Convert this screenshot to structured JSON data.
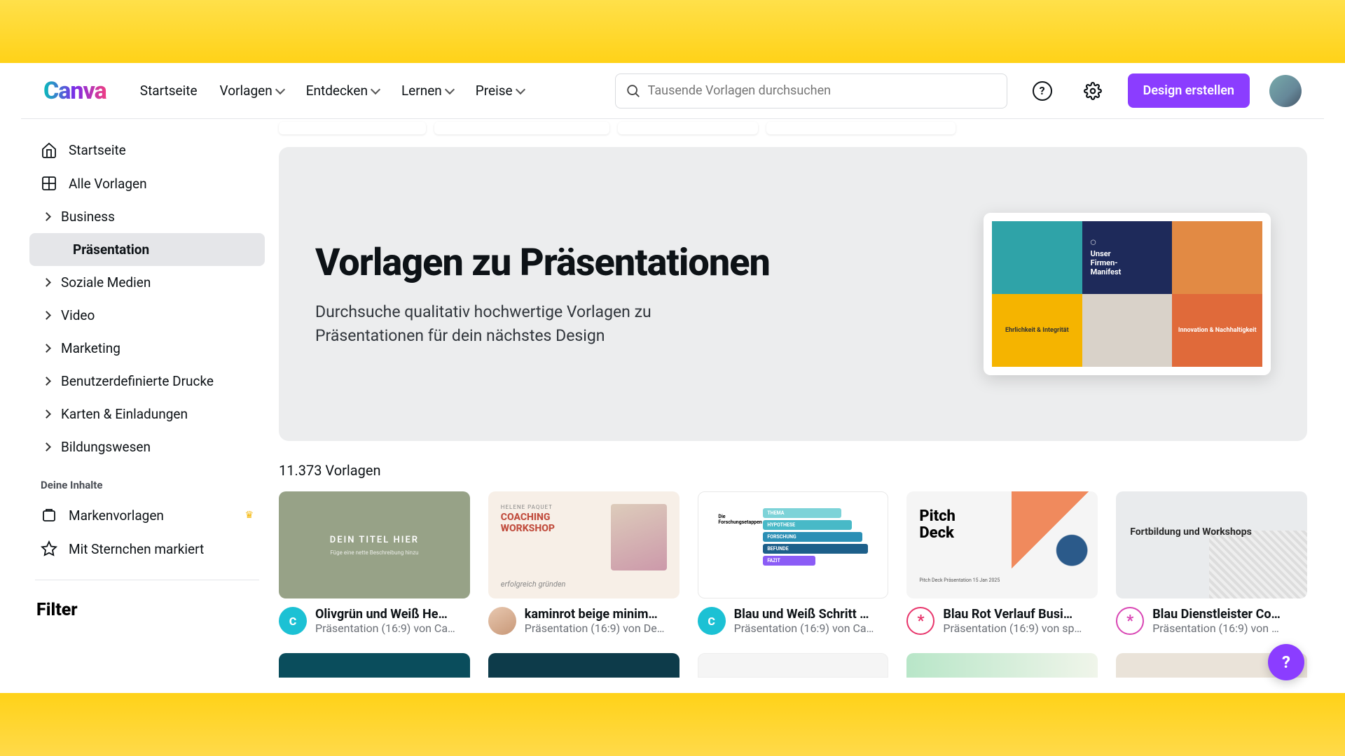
{
  "header": {
    "logo": "Canva",
    "nav": [
      "Startseite",
      "Vorlagen",
      "Entdecken",
      "Lernen",
      "Preise"
    ],
    "search_placeholder": "Tausende Vorlagen durchsuchen",
    "create_label": "Design erstellen"
  },
  "sidebar": {
    "items": [
      {
        "label": "Startseite",
        "icon": "home"
      },
      {
        "label": "Alle Vorlagen",
        "icon": "grid"
      },
      {
        "label": "Business",
        "icon": "chev"
      },
      {
        "label": "Präsentation",
        "icon": "none",
        "active": true,
        "sub": true
      },
      {
        "label": "Soziale Medien",
        "icon": "chev"
      },
      {
        "label": "Video",
        "icon": "chev"
      },
      {
        "label": "Marketing",
        "icon": "chev"
      },
      {
        "label": "Benutzerdefinierte Drucke",
        "icon": "chev"
      },
      {
        "label": "Karten & Einladungen",
        "icon": "chev"
      },
      {
        "label": "Bildungswesen",
        "icon": "chev"
      }
    ],
    "section2_label": "Deine Inhalte",
    "section2_items": [
      {
        "label": "Markenvorlagen",
        "icon": "brand",
        "crown": true
      },
      {
        "label": "Mit Sternchen markiert",
        "icon": "star"
      }
    ],
    "filter_label": "Filter"
  },
  "hero": {
    "title": "Vorlagen zu Präsentationen",
    "description": "Durchsuche qualitativ hochwertige Vorlagen zu Präsentationen für dein nächstes Design",
    "preview": {
      "cell2_line1": "Unser",
      "cell2_line2": "Firmen-",
      "cell2_line3": "Manifest",
      "cell4": "Ehrlichkeit & Integrität",
      "cell6": "Innovation & Nachhaltigkeit"
    }
  },
  "results": {
    "count_label": "11.373 Vorlagen"
  },
  "templates": [
    {
      "title": "Olivgrün und Weiß He…",
      "subtitle": "Präsentation (16:9) von Ca…",
      "avatar_color": "#1cc1d4",
      "thumb": {
        "line1": "DEIN TITEL HIER",
        "line2": "Füge eine nette Beschreibung hinzu"
      }
    },
    {
      "title": "kaminrot beige minim…",
      "subtitle": "Präsentation (16:9) von De…",
      "avatar_color": "#d8b8a8",
      "thumb": {
        "tag": "HELENE PAQUET",
        "l1": "COACHING",
        "l2": "WORKSHOP",
        "sig": "erfolgreich gründen"
      }
    },
    {
      "title": "Blau und Weiß Schritt …",
      "subtitle": "Präsentation (16:9) von Ca…",
      "avatar_color": "#1cc1d4",
      "thumb": {
        "left_title": "Die Forschungsetappen",
        "s1": "THEMA",
        "s2": "HYPOTHESE",
        "s3": "FORSCHUNG",
        "s4": "BEFUNDE",
        "s5": "FAZIT"
      }
    },
    {
      "title": "Blau Rot Verlauf Busi…",
      "subtitle": "Präsentation (16:9) von sp…",
      "avatar_color": "#e8356b",
      "thumb": {
        "title": "Pitch\nDeck",
        "date": "Pitch Deck Präsentation   15 Jan 2025"
      }
    },
    {
      "title": "Blau Dienstleister Co…",
      "subtitle": "Präsentation (16:9) von …",
      "avatar_color": "#d946b4",
      "thumb": {
        "title": "Fortbildung und Workshops"
      }
    }
  ],
  "fab": {
    "label": "?"
  }
}
